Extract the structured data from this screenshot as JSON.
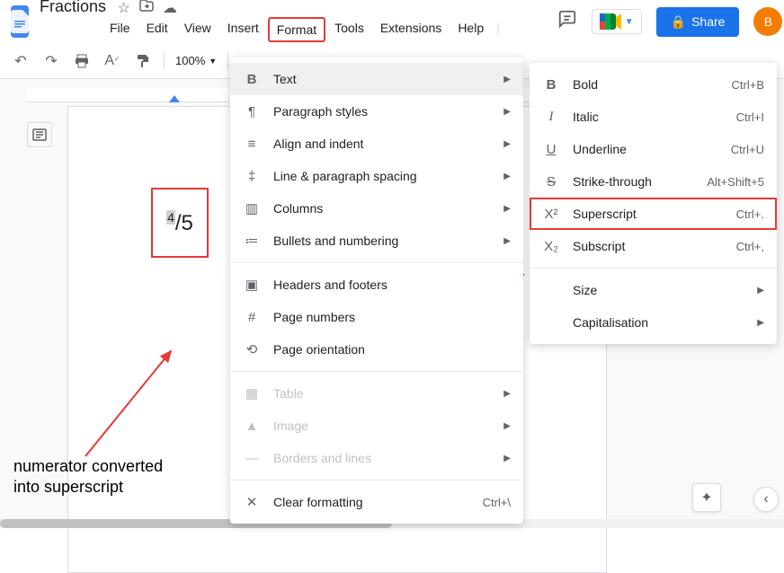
{
  "doc": {
    "title": "Fractions",
    "avatar_letter": "B"
  },
  "header_buttons": {
    "share": "Share"
  },
  "menubar": [
    "File",
    "Edit",
    "View",
    "Insert",
    "Format",
    "Tools",
    "Extensions",
    "Help"
  ],
  "toolbar": {
    "zoom": "100%"
  },
  "page_content": {
    "numerator": "4",
    "rest": "/5"
  },
  "annotation": {
    "line1": "numerator converted",
    "line2": "into superscript"
  },
  "format_menu": [
    {
      "icon": "B",
      "label": "Text",
      "arrow": true,
      "hovered": true,
      "bold": true
    },
    {
      "icon": "¶",
      "label": "Paragraph styles",
      "arrow": true
    },
    {
      "icon": "≡",
      "label": "Align and indent",
      "arrow": true
    },
    {
      "icon": "‡",
      "label": "Line & paragraph spacing",
      "arrow": true
    },
    {
      "icon": "▥",
      "label": "Columns",
      "arrow": true
    },
    {
      "icon": "≔",
      "label": "Bullets and numbering",
      "arrow": true
    },
    {
      "sep": true
    },
    {
      "icon": "▣",
      "label": "Headers and footers"
    },
    {
      "icon": "#",
      "label": "Page numbers"
    },
    {
      "icon": "⟲",
      "label": "Page orientation"
    },
    {
      "sep": true
    },
    {
      "icon": "▦",
      "label": "Table",
      "arrow": true,
      "disabled": true
    },
    {
      "icon": "▲",
      "label": "Image",
      "arrow": true,
      "disabled": true
    },
    {
      "icon": "—",
      "label": "Borders and lines",
      "arrow": true,
      "disabled": true
    },
    {
      "sep": true
    },
    {
      "icon": "✕",
      "label": "Clear formatting",
      "shortcut": "Ctrl+\\"
    }
  ],
  "text_submenu": [
    {
      "icon": "B",
      "label": "Bold",
      "shortcut": "Ctrl+B",
      "bold": true
    },
    {
      "icon": "I",
      "label": "Italic",
      "shortcut": "Ctrl+I",
      "italic": true
    },
    {
      "icon": "U",
      "label": "Underline",
      "shortcut": "Ctrl+U",
      "underline": true
    },
    {
      "icon": "S",
      "label": "Strike-through",
      "shortcut": "Alt+Shift+5",
      "strike": true
    },
    {
      "icon": "X²",
      "label": "Superscript",
      "shortcut": "Ctrl+.",
      "highlighted": true
    },
    {
      "icon": "X₂",
      "label": "Subscript",
      "shortcut": "Ctrl+,"
    },
    {
      "sep": true
    },
    {
      "icon": "",
      "label": "Size",
      "arrow": true
    },
    {
      "icon": "",
      "label": "Capitalisation",
      "arrow": true
    }
  ]
}
